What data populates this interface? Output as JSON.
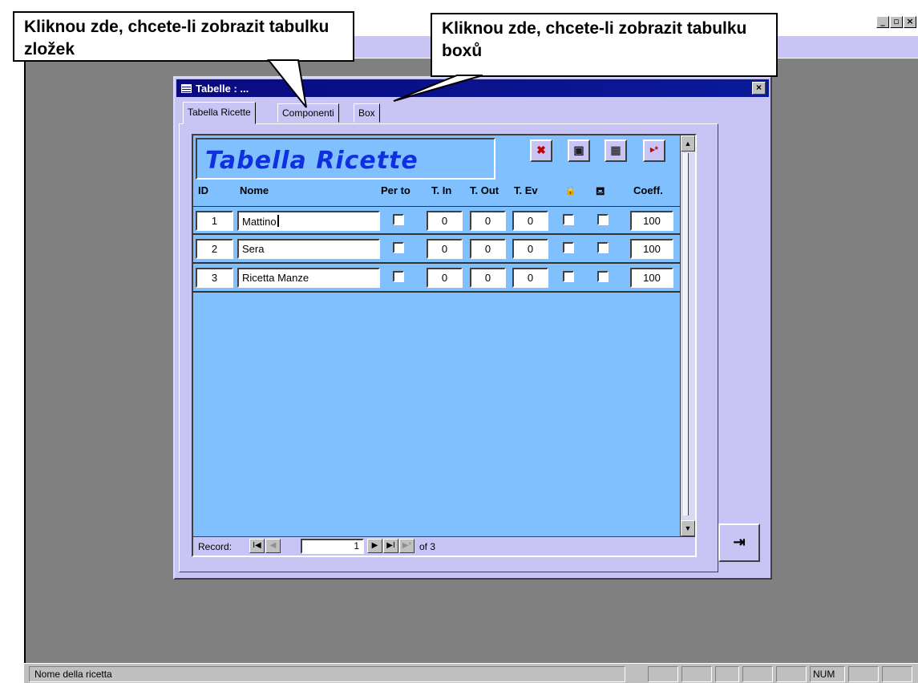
{
  "window": {
    "min_label": "_",
    "restore_label": "▫",
    "close_label": "×"
  },
  "form": {
    "title": "Tabelle : ...",
    "close_label": "×",
    "tabs": [
      {
        "label": "Tabella Ricette",
        "active": true
      },
      {
        "label": "Componenti",
        "active": false
      },
      {
        "label": "Box",
        "active": false
      }
    ],
    "exit_label": "⇥"
  },
  "subform": {
    "title": "Tabella Ricette",
    "toolbar": {
      "delete_label": "✖",
      "save_label": "▣",
      "calc_label": "▦",
      "new_label": "▸*"
    },
    "columns": [
      "ID",
      "Nome",
      "Per to",
      "T. In",
      "T. Out",
      "T. Ev",
      "🔒",
      "⛾",
      "Coeff."
    ],
    "rows": [
      {
        "id": "1",
        "nome": "Mattino",
        "t_in": "0",
        "t_out": "0",
        "t_ev": "0",
        "coeff": "100"
      },
      {
        "id": "2",
        "nome": "Sera",
        "t_in": "0",
        "t_out": "0",
        "t_ev": "0",
        "coeff": "100"
      },
      {
        "id": "3",
        "nome": "Ricetta Manze",
        "t_in": "0",
        "t_out": "0",
        "t_ev": "0",
        "coeff": "100"
      }
    ],
    "scroll": {
      "up": "▲",
      "down": "▼"
    }
  },
  "navigation": {
    "record_label": "Record:",
    "first": "I◀",
    "prev": "◀",
    "current": "1",
    "next": "▶",
    "last": "▶I",
    "new": "▶*",
    "of_text": "of 3"
  },
  "callouts": {
    "components": "Kliknou zde, chcete-li zobrazit tabulku zložek",
    "box": "Kliknou zde, chcete-li zobrazit tabulku boxů"
  },
  "statusbar": {
    "text": "Nome della ricetta",
    "num": "NUM"
  }
}
